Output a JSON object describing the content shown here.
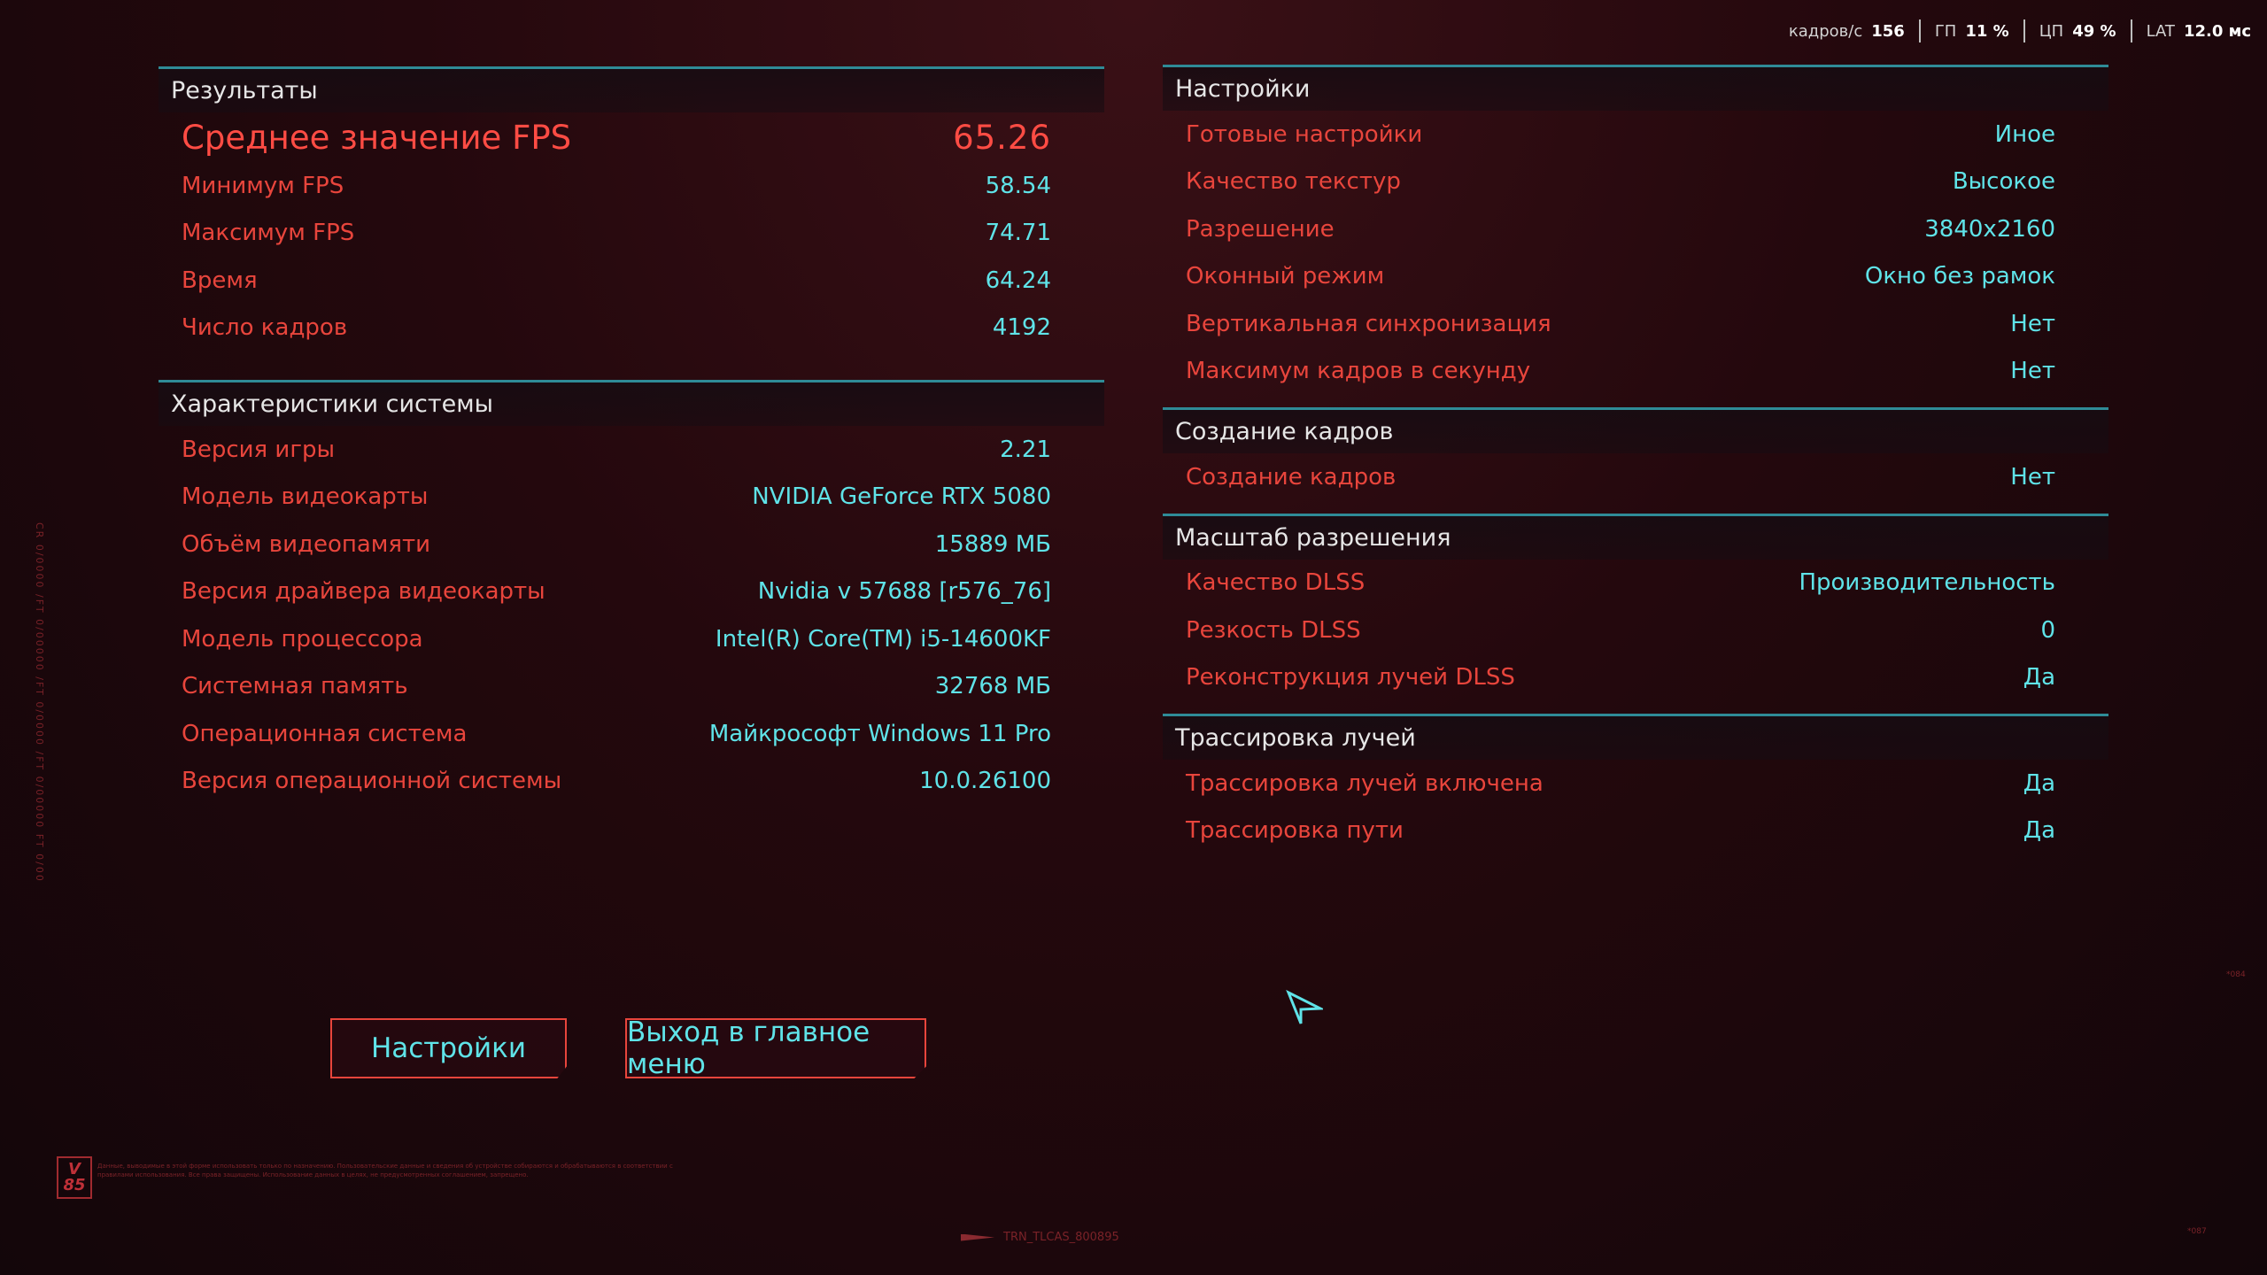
{
  "overlay": {
    "fps_label": "кадров/с",
    "fps_value": "156",
    "gpu_label": "ГП",
    "gpu_value": "11 %",
    "cpu_label": "ЦП",
    "cpu_value": "49 %",
    "lat_label": "LAT",
    "lat_value": "12.0 мс"
  },
  "results": {
    "title": "Результаты",
    "rows": [
      {
        "k": "Среднее значение FPS",
        "v": "65.26"
      },
      {
        "k": "Минимум FPS",
        "v": "58.54"
      },
      {
        "k": "Максимум FPS",
        "v": "74.71"
      },
      {
        "k": "Время",
        "v": "64.24"
      },
      {
        "k": "Число кадров",
        "v": "4192"
      }
    ]
  },
  "system": {
    "title": "Характеристики системы",
    "rows": [
      {
        "k": "Версия игры",
        "v": "2.21"
      },
      {
        "k": "Модель видеокарты",
        "v": "NVIDIA GeForce RTX 5080"
      },
      {
        "k": "Объём видеопамяти",
        "v": "15889 МБ"
      },
      {
        "k": "Версия драйвера видеокарты",
        "v": "Nvidia v 57688 [r576_76]"
      },
      {
        "k": "Модель процессора",
        "v": "Intel(R) Core(TM) i5-14600KF"
      },
      {
        "k": "Системная память",
        "v": "32768 МБ"
      },
      {
        "k": "Операционная система",
        "v": "Майкрософт Windows 11 Pro"
      },
      {
        "k": "Версия операционной системы",
        "v": "10.0.26100"
      }
    ]
  },
  "settings": {
    "title": "Настройки",
    "rows": [
      {
        "k": "Готовые настройки",
        "v": "Иное"
      },
      {
        "k": "Качество текстур",
        "v": "Высокое"
      },
      {
        "k": "Разрешение",
        "v": "3840x2160"
      },
      {
        "k": "Оконный режим",
        "v": "Окно без рамок"
      },
      {
        "k": "Вертикальная синхронизация",
        "v": "Нет"
      },
      {
        "k": "Максимум кадров в секунду",
        "v": "Нет"
      }
    ]
  },
  "framegen": {
    "title": "Создание кадров",
    "rows": [
      {
        "k": "Создание кадров",
        "v": "Нет"
      }
    ]
  },
  "scaling": {
    "title": "Масштаб разрешения",
    "rows": [
      {
        "k": "Качество DLSS",
        "v": "Производительность"
      },
      {
        "k": "Резкость DLSS",
        "v": "0"
      },
      {
        "k": "Реконструкция лучей DLSS",
        "v": "Да"
      }
    ]
  },
  "raytracing": {
    "title": "Трассировка лучей",
    "rows": [
      {
        "k": "Трассировка лучей включена",
        "v": "Да"
      },
      {
        "k": "Трассировка пути",
        "v": "Да"
      }
    ]
  },
  "buttons": {
    "settings": "Настройки",
    "exit": "Выход в главное меню"
  },
  "decor": {
    "side_text": "CR 0/0000 /FT 0/00000 /FT 0/0000 /FT 0/00000 FT 0/00",
    "logo_line1": "V",
    "logo_line2": "85",
    "legal": "Данные, выводимые в этой форме использовать только по назначению. Пользовательские данные и сведения об устройстве собираются и обрабатываются в соответствии с правилами использования. Все права защищены. Использование данных в целях, не предусмотренных соглашением, запрещено.",
    "bottom_code": "TRN_TLCAS_800895",
    "tag_right": "*084",
    "tag_bottom_right": "*087"
  },
  "colors": {
    "accent_red": "#e8453c",
    "accent_cyan": "#5fe3e8",
    "divider_teal": "#2f8b97"
  }
}
